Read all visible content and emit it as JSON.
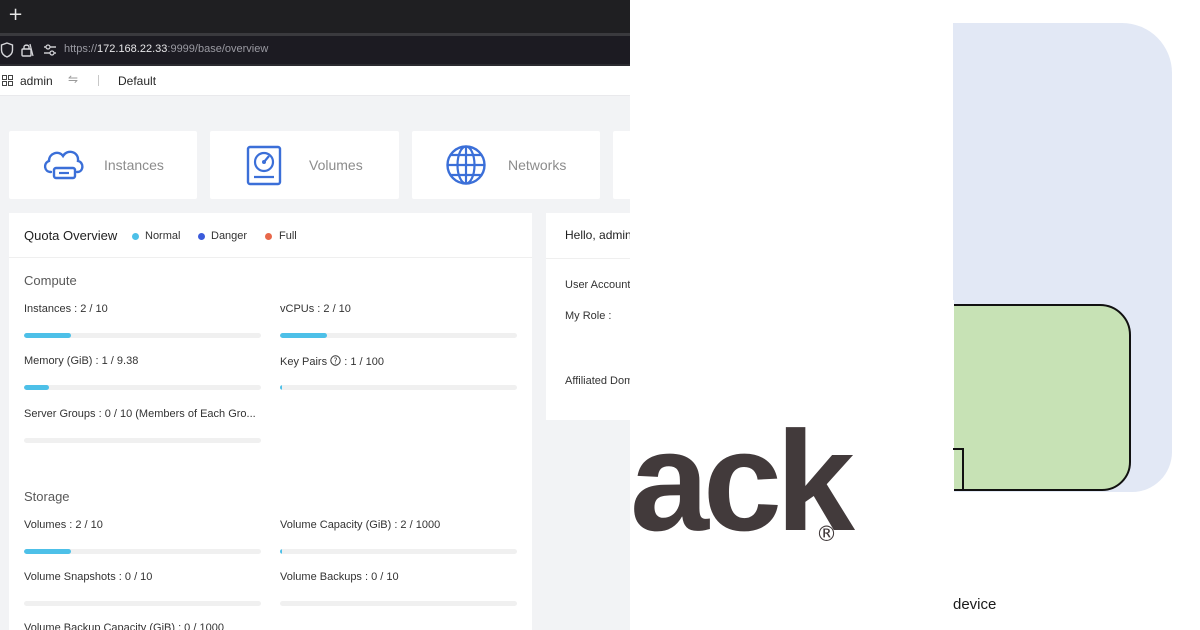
{
  "browser": {
    "new_tab_glyph": "+",
    "url": {
      "scheme": "https://",
      "host": "172.168.22.33",
      "rest": ":9999/base/overview"
    }
  },
  "topnav": {
    "user": "admin",
    "project": "Default"
  },
  "tiles": [
    {
      "label": "Instances",
      "icon": "cloud-server-icon"
    },
    {
      "label": "Volumes",
      "icon": "hard-disk-icon"
    },
    {
      "label": "Networks",
      "icon": "globe-icon"
    }
  ],
  "quota": {
    "title": "Quota Overview",
    "legend": [
      {
        "label": "Normal",
        "color": "#4dc0e8"
      },
      {
        "label": "Danger",
        "color": "#3b5bdb"
      },
      {
        "label": "Full",
        "color": "#e8684a"
      }
    ],
    "compute_title": "Compute",
    "compute": [
      {
        "label": "Instances : 2 / 10",
        "used": 2,
        "limit": 10
      },
      {
        "label": "vCPUs : 2 / 10",
        "used": 2,
        "limit": 10
      },
      {
        "label": "Memory (GiB) : 1 / 9.38",
        "used": 1,
        "limit": 9.38
      },
      {
        "label": "Key Pairs",
        "label_suffix": ": 1 / 100",
        "used": 1,
        "limit": 100
      },
      {
        "label": "Server Groups : 0 / 10 (Members of Each Gro...",
        "used": 0,
        "limit": 10
      }
    ],
    "storage_title": "Storage",
    "storage": [
      {
        "label": "Volumes : 2 / 10",
        "used": 2,
        "limit": 10
      },
      {
        "label": "Volume Capacity (GiB) : 2 / 1000",
        "used": 2,
        "limit": 1000
      },
      {
        "label": "Volume Snapshots : 0 / 10",
        "used": 0,
        "limit": 10
      },
      {
        "label": "Volume Backups : 0 / 10",
        "used": 0,
        "limit": 10
      },
      {
        "label": "Volume Backup Capacity (GiB) : 0 / 1000",
        "used": 0,
        "limit": 1000
      }
    ]
  },
  "hello": {
    "title": "Hello, admin",
    "user_account": "User Account",
    "my_role": "My Role :",
    "affiliated_domain": "Affiliated Dom"
  },
  "slide": {
    "logo_fragment": "ack",
    "registered_mark": "®",
    "device_text": "device",
    "colors": {
      "back_panel": "#e2e8f5",
      "front_panel": "#c7e2b5",
      "logo_text": "#423a3b"
    }
  }
}
